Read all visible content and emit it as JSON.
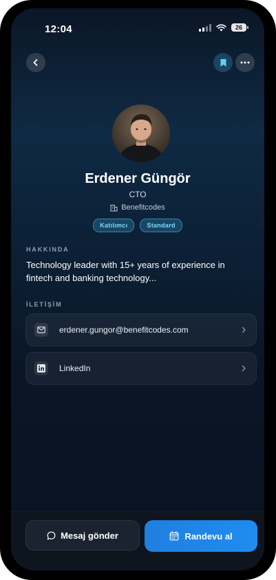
{
  "status_bar": {
    "time": "12:04",
    "battery": "26"
  },
  "header": {
    "back_icon": "chevron-left-icon",
    "bookmark_icon": "bookmark-icon",
    "more_icon": "more-horizontal-icon"
  },
  "profile": {
    "name": "Erdener Güngör",
    "role": "CTO",
    "company": "Benefitcodes",
    "badges": [
      "Katılımcı",
      "Standard"
    ]
  },
  "about": {
    "label": "HAKKINDA",
    "text": "Technology leader with 15+ years of experience in fintech and banking technology..."
  },
  "contact": {
    "label": "İLETİŞİM",
    "items": [
      {
        "icon": "mail-icon",
        "text": "erdener.gungor@benefitcodes.com"
      },
      {
        "icon": "linkedin-icon",
        "text": "LinkedIn"
      }
    ]
  },
  "actions": {
    "message_label": "Mesaj gönder",
    "appointment_label": "Randevu al"
  },
  "colors": {
    "accent": "#1f85ea",
    "badge_text": "#7fd9ff",
    "background_top": "#0f2a44",
    "background_bottom": "#0a1220"
  }
}
